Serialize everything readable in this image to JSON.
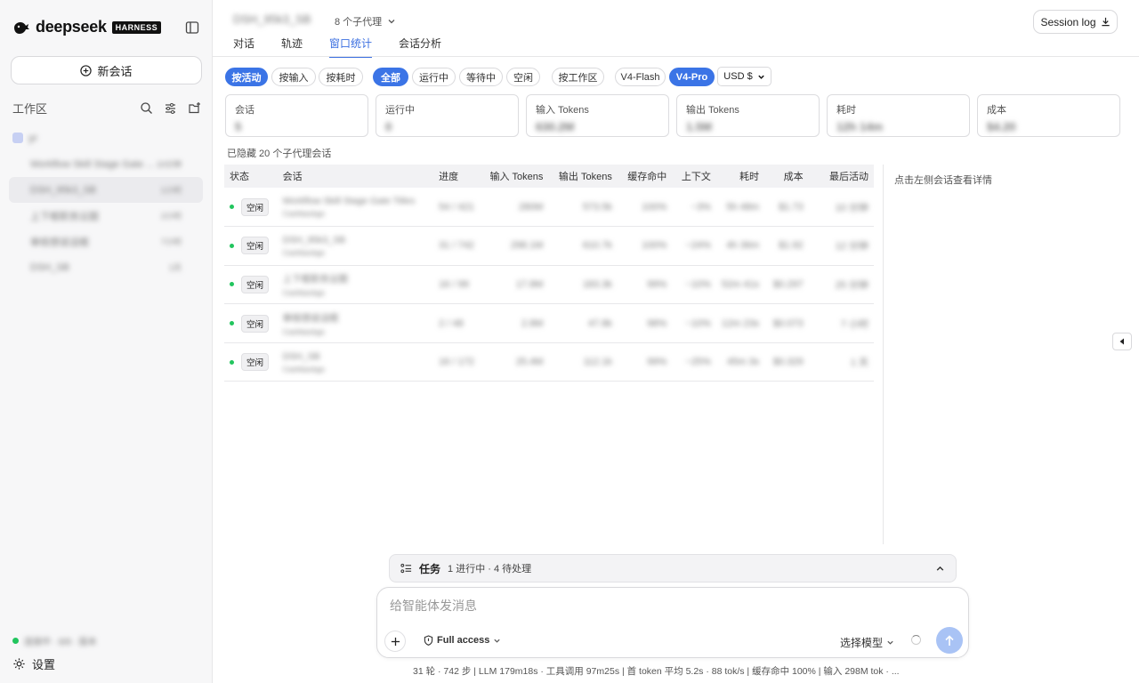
{
  "sidebar": {
    "logo_word": "deepseek",
    "logo_badge": "HARNESS",
    "new_chat_label": "新会话",
    "workspace_title": "工作区",
    "group_name": "yr",
    "sessions": [
      {
        "name": "Workflow Skill Stage Gate ...",
        "time": "10分钟"
      },
      {
        "name": "DSH_95k3_SB",
        "time": "1小时"
      },
      {
        "name": "上下框职务议题",
        "time": "2小时"
      },
      {
        "name": "审核想说话框",
        "time": "7小时"
      },
      {
        "name": "DSH_SB",
        "time": "1天"
      }
    ],
    "status_text": "连接中 · 8/8 · 版本",
    "settings_label": "设置"
  },
  "header": {
    "title": "DSH_95k3_SB",
    "agents_label": "8 个子代理",
    "session_log_label": "Session log",
    "tabs": [
      "对话",
      "轨迹",
      "窗口统计",
      "会话分析"
    ]
  },
  "filters": {
    "sort": [
      "按活动",
      "按输入",
      "按耗时"
    ],
    "status": [
      "全部",
      "运行中",
      "等待中",
      "空闲"
    ],
    "group": "按工作区",
    "models": [
      "V4-Flash",
      "V4-Pro"
    ],
    "currency": "USD $"
  },
  "cards": [
    {
      "label": "会话",
      "value": "5"
    },
    {
      "label": "运行中",
      "value": "0"
    },
    {
      "label": "输入 Tokens",
      "value": "630.2M"
    },
    {
      "label": "输出 Tokens",
      "value": "1.5M"
    },
    {
      "label": "耗时",
      "value": "12h 14m"
    },
    {
      "label": "成本",
      "value": "$4.20"
    }
  ],
  "hidden_note": "已隐藏 20 个子代理会话",
  "table": {
    "headers": [
      "状态",
      "会话",
      "进度",
      "输入 Tokens",
      "输出 Tokens",
      "缓存命中",
      "上下文",
      "耗时",
      "成本",
      "最后活动"
    ],
    "status_label": "空闲",
    "rows": [
      {
        "name": "Workflow Skill Stage Gate Titles",
        "sub": "Cashbackgo",
        "progress": "54 / 421",
        "input": "280M",
        "output": "573.5k",
        "cache": "100%",
        "context": "~3%",
        "time": "5h 48m",
        "cost": "$1.73",
        "last": "10 分钟"
      },
      {
        "name": "DSH_95k3_SB",
        "sub": "Cashbackgo",
        "progress": "31 / 742",
        "input": "298.1M",
        "output": "610.7k",
        "cache": "100%",
        "context": "~24%",
        "time": "4h 36m",
        "cost": "$1.92",
        "last": "12 分钟"
      },
      {
        "name": "上下框职务议题",
        "sub": "Cashbackgo",
        "progress": "16 / 99",
        "input": "17.8M",
        "output": "183.3k",
        "cache": "99%",
        "context": "~10%",
        "time": "52m 41s",
        "cost": "$0.297",
        "last": "25 分钟"
      },
      {
        "name": "审核想说话框",
        "sub": "Cashbackgo",
        "progress": "2 / 48",
        "input": "2.8M",
        "output": "47.8k",
        "cache": "98%",
        "context": "~10%",
        "time": "12m 23s",
        "cost": "$0.073",
        "last": "7 小时"
      },
      {
        "name": "DSH_SB",
        "sub": "Cashbackgo",
        "progress": "16 / 172",
        "input": "25.4M",
        "output": "112.1k",
        "cache": "99%",
        "context": "~25%",
        "time": "45m 3s",
        "cost": "$0.329",
        "last": "1 天"
      }
    ]
  },
  "detail_hint": "点击左侧会话查看详情",
  "tasks": {
    "title": "任务",
    "stats": "1 进行中 · 4 待处理"
  },
  "composer": {
    "placeholder": "给智能体发消息",
    "access_label": "Full access",
    "model_label": "选择模型"
  },
  "footer_stats": "31 轮 · 742 步  |  LLM 179m18s · 工具调用 97m25s  |  首 token 平均 5.2s · 88 tok/s  |  缓存命中 100%  |  输入 298M tok · ..."
}
